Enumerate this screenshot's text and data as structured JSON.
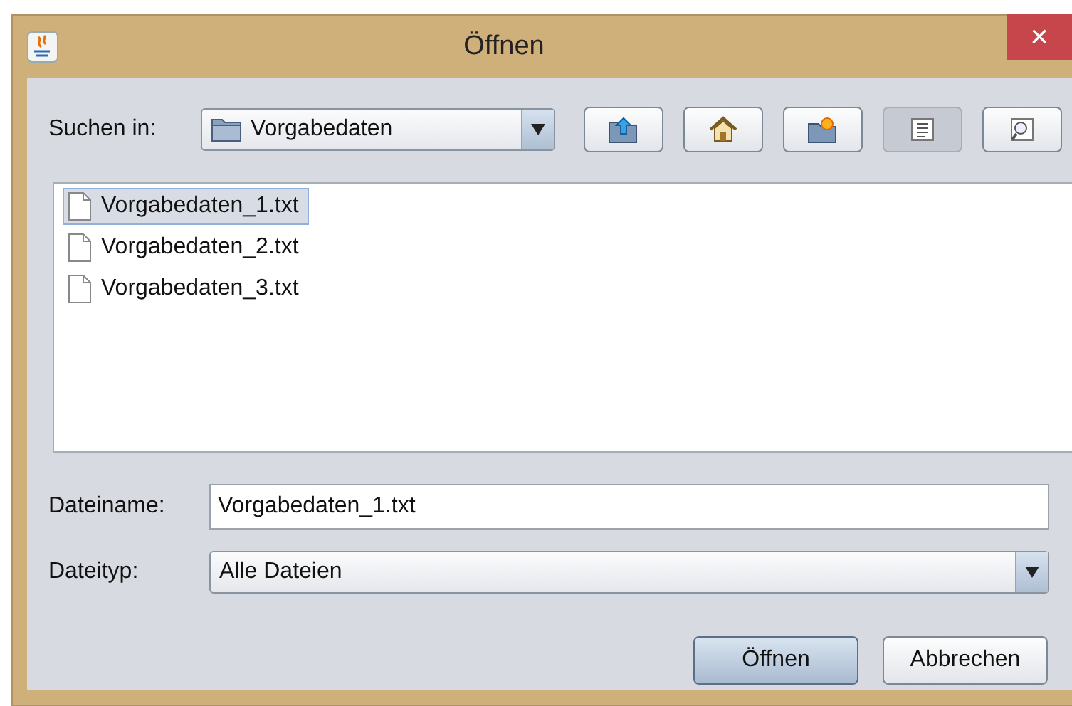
{
  "window": {
    "title": "Öffnen",
    "close": "×"
  },
  "look_in": {
    "label": "Suchen in:",
    "value": "Vorgabedaten"
  },
  "toolbar": [
    {
      "kind": "up",
      "selected": false
    },
    {
      "kind": "home",
      "selected": false
    },
    {
      "kind": "newfolder",
      "selected": false
    },
    {
      "kind": "list",
      "selected": true
    },
    {
      "kind": "details",
      "selected": false
    }
  ],
  "files": [
    {
      "name": "Vorgabedaten_1.txt",
      "selected": true
    },
    {
      "name": "Vorgabedaten_2.txt",
      "selected": false
    },
    {
      "name": "Vorgabedaten_3.txt",
      "selected": false
    }
  ],
  "file_name": {
    "label": "Dateiname:",
    "value": "Vorgabedaten_1.txt"
  },
  "file_type": {
    "label": "Dateityp:",
    "value": "Alle Dateien"
  },
  "buttons": [
    {
      "label": "Öffnen",
      "default": true
    },
    {
      "label": "Abbrechen",
      "default": false
    }
  ]
}
